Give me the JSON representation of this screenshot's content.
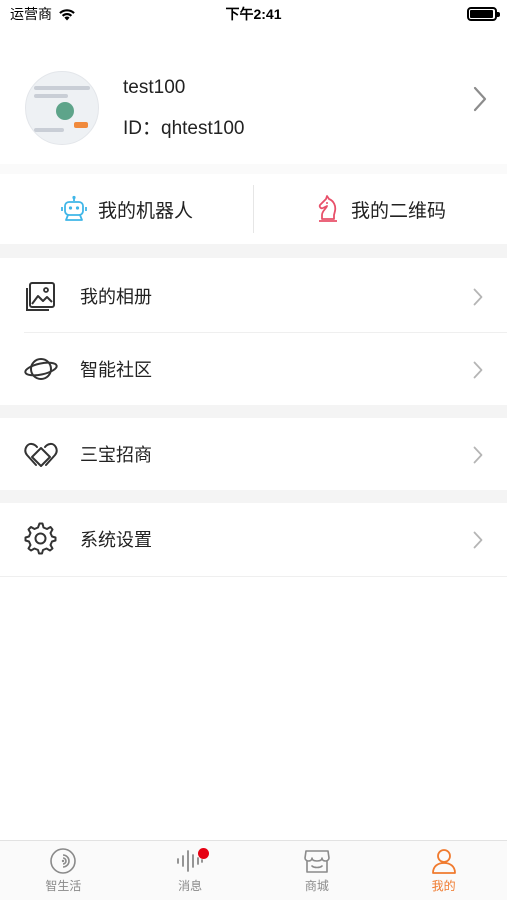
{
  "status_bar": {
    "carrier": "运营商",
    "time": "下午2:41",
    "battery_level": 0.95
  },
  "profile": {
    "username": "test100",
    "user_id": "ID：qhtest100"
  },
  "quick_actions": [
    {
      "label": "我的机器人",
      "icon": "robot-icon",
      "color": "#3fb6e8"
    },
    {
      "label": "我的二维码",
      "icon": "chess-knight-icon",
      "color": "#e8506a"
    }
  ],
  "menu": {
    "album": "我的相册",
    "community": "智能社区",
    "investment": "三宝招商",
    "settings": "系统设置"
  },
  "tab_bar": {
    "tabs": [
      {
        "label": "智生活",
        "icon": "smart-life-icon",
        "active": false
      },
      {
        "label": "消息",
        "icon": "message-waveform-icon",
        "active": false,
        "badge": true
      },
      {
        "label": "商城",
        "icon": "shop-icon",
        "active": false
      },
      {
        "label": "我的",
        "icon": "person-icon",
        "active": true
      }
    ],
    "active_color": "#f07a2e",
    "inactive_color": "#8a8a8a"
  }
}
